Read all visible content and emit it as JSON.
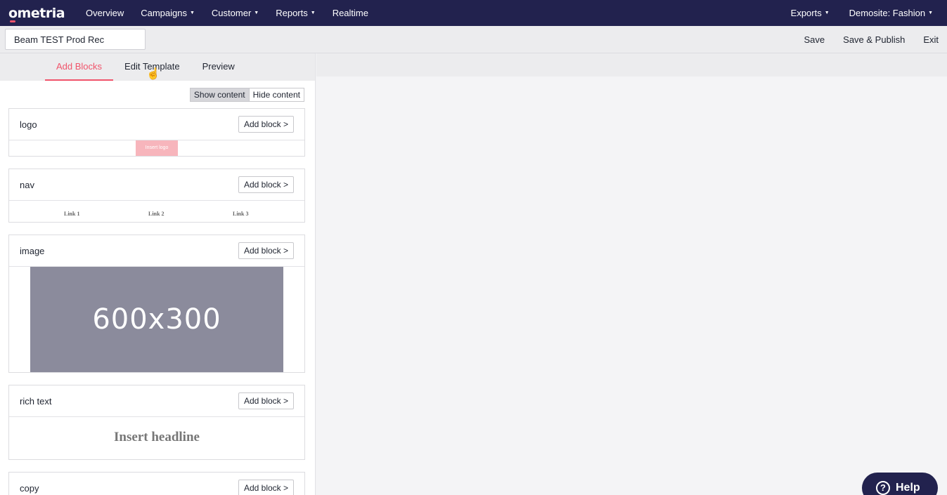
{
  "brand": {
    "name": "ometria"
  },
  "topnav": {
    "left": [
      {
        "label": "Overview",
        "caret": false
      },
      {
        "label": "Campaigns",
        "caret": true
      },
      {
        "label": "Customer",
        "caret": true
      },
      {
        "label": "Reports",
        "caret": true
      },
      {
        "label": "Realtime",
        "caret": false
      }
    ],
    "right": [
      {
        "label": "Exports",
        "caret": true
      },
      {
        "label": "Demosite: Fashion",
        "caret": true
      }
    ]
  },
  "subheader": {
    "template_name": "Beam TEST Prod Rec",
    "save": "Save",
    "save_publish": "Save & Publish",
    "exit": "Exit"
  },
  "tabs": {
    "add_blocks": "Add Blocks",
    "edit_template": "Edit Template",
    "preview": "Preview",
    "active": "add_blocks"
  },
  "toggle": {
    "show": "Show content",
    "hide": "Hide content",
    "active": "show"
  },
  "blocks": {
    "add_label": "Add block >",
    "logo": {
      "title": "logo",
      "placeholder": "Insert logo"
    },
    "nav": {
      "title": "nav",
      "links": [
        "Link 1",
        "Link 2",
        "Link 3"
      ]
    },
    "image": {
      "title": "image",
      "placeholder": "600x300"
    },
    "rich_text": {
      "title": "rich text",
      "headline": "Insert headline"
    },
    "copy": {
      "title": "copy"
    }
  },
  "help": {
    "label": "Help"
  },
  "colors": {
    "nav_bg": "#22224e",
    "accent": "#f0546b",
    "logo_placeholder": "#f7b5bc",
    "image_placeholder": "#8b8b9c"
  }
}
